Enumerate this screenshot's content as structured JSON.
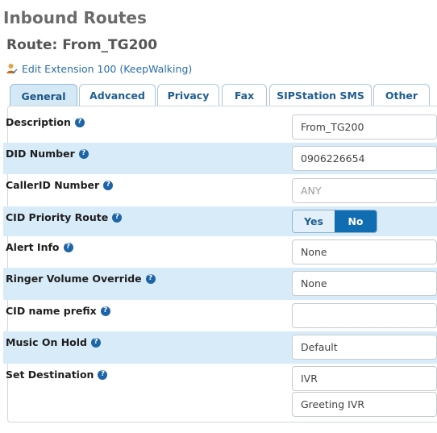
{
  "header": {
    "page_title": "Inbound Routes",
    "route_title": "Route: From_TG200",
    "edit_link": "Edit Extension 100 (KeepWalking)"
  },
  "tabs": [
    {
      "label": "General",
      "active": true
    },
    {
      "label": "Advanced",
      "active": false
    },
    {
      "label": "Privacy",
      "active": false
    },
    {
      "label": "Fax",
      "active": false
    },
    {
      "label": "SIPStation SMS",
      "active": false
    },
    {
      "label": "Other",
      "active": false
    }
  ],
  "form": {
    "description": {
      "label": "Description",
      "value": "From_TG200"
    },
    "did_number": {
      "label": "DID Number",
      "value": "0906226654"
    },
    "callerid_number": {
      "label": "CallerID Number",
      "placeholder": "ANY"
    },
    "cid_priority": {
      "label": "CID Priority Route",
      "yes_label": "Yes",
      "no_label": "No",
      "selected": "No"
    },
    "alert_info": {
      "label": "Alert Info",
      "value": "None"
    },
    "ringer_volume": {
      "label": "Ringer Volume Override",
      "value": "None"
    },
    "cid_name_prefix": {
      "label": "CID name prefix",
      "value": ""
    },
    "music_on_hold": {
      "label": "Music On Hold",
      "value": "Default"
    },
    "set_destination": {
      "label": "Set Destination",
      "type_value": "IVR",
      "target_value": "Greeting IVR"
    }
  },
  "help_icon_glyph": "?",
  "colors": {
    "tab_text": "#1f5d8f",
    "active_tab_bg": "#d5e8f6",
    "alt_row_bg": "#d8ebf8",
    "toggle_selected": "#116db2",
    "help_icon": "#1d65a6"
  }
}
